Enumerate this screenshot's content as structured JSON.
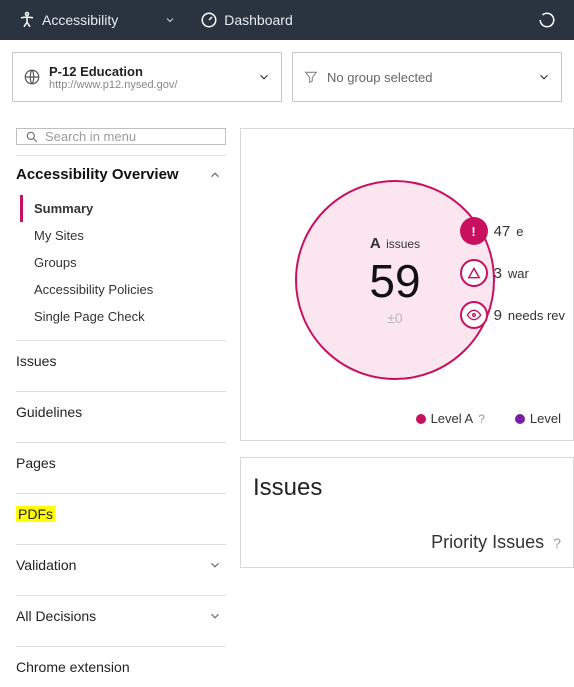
{
  "topnav": {
    "accessibility": "Accessibility",
    "dashboard": "Dashboard"
  },
  "selectors": {
    "site": {
      "title": "P-12 Education",
      "url": "http://www.p12.nysed.gov/"
    },
    "group": {
      "label": "No group selected"
    }
  },
  "sidebar": {
    "search_placeholder": "Search in menu",
    "overview_header": "Accessibility Overview",
    "overview_items": [
      "Summary",
      "My Sites",
      "Groups",
      "Accessibility Policies",
      "Single Page Check"
    ],
    "items": [
      {
        "label": "Issues",
        "chevron": false
      },
      {
        "label": "Guidelines",
        "chevron": false
      },
      {
        "label": "Pages",
        "chevron": false
      },
      {
        "label": "PDFs",
        "chevron": false,
        "highlight": true
      },
      {
        "label": "Validation",
        "chevron": true
      },
      {
        "label": "All Decisions",
        "chevron": true
      },
      {
        "label": "Chrome extension",
        "chevron": false
      }
    ]
  },
  "chart_data": {
    "type": "pie",
    "title_prefix": "A",
    "title_suffix": "issues",
    "value": 59,
    "delta": "±0",
    "badges": [
      {
        "kind": "error",
        "value": 47,
        "label": "e"
      },
      {
        "kind": "warn",
        "value": 3,
        "label": "war"
      },
      {
        "kind": "review",
        "value": 9,
        "label": "needs rev"
      }
    ],
    "legend": [
      {
        "color": "#c8105e",
        "label": "Level A"
      },
      {
        "color": "#7a1fa2",
        "label": "Level "
      }
    ]
  },
  "issues_section": {
    "heading": "Issues",
    "priority": "Priority Issues"
  }
}
